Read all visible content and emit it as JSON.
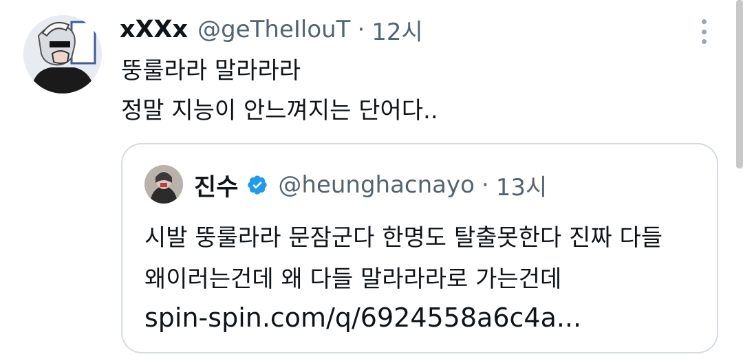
{
  "tweet": {
    "display_name": "xXXx",
    "handle": "@geTheIlouT",
    "separator": "·",
    "time": "12시",
    "lines": [
      "뚱룰라라 말라라라",
      "정말 지능이 안느껴지는 단어다.."
    ],
    "avatar_icon": "profile-avatar-illustration",
    "more_icon": "vertical-ellipsis-icon"
  },
  "quote": {
    "display_name": "진수",
    "verified_icon": "verified-badge-icon",
    "handle": "@heunghacnayo",
    "separator": "·",
    "time": "13시",
    "lines": [
      "시발 뚱룰라라 문잠군다 한명도 탈출못한다 진짜 다들",
      "왜이러는건데 왜 다들 말라라라로 가는건데"
    ],
    "link": "spin-spin.com/q/6924558a6c4a...",
    "avatar_icon": "profile-avatar-photo"
  },
  "colors": {
    "text_primary": "#0f1419",
    "text_secondary": "#536471",
    "border": "#d4dbe1",
    "verified": "#1d9bf0"
  }
}
